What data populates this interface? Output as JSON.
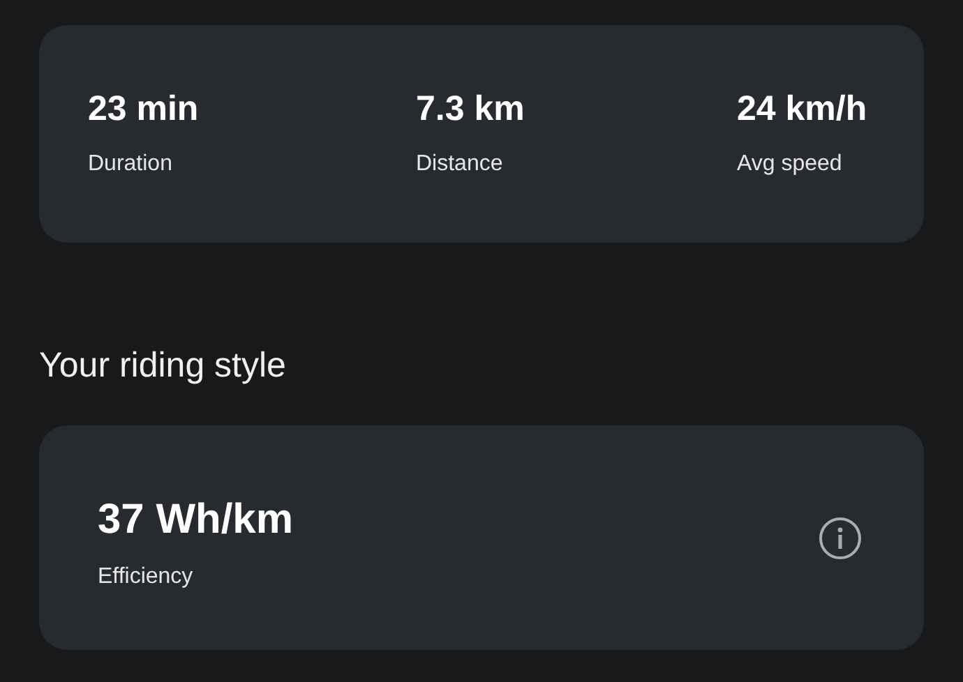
{
  "trip_stats": [
    {
      "value": "23 min",
      "label": "Duration"
    },
    {
      "value": "7.3 km",
      "label": "Distance"
    },
    {
      "value": "24 km/h",
      "label": "Avg speed"
    }
  ],
  "section_title": "Your riding style",
  "efficiency": {
    "value": "37 Wh/km",
    "label": "Efficiency"
  }
}
